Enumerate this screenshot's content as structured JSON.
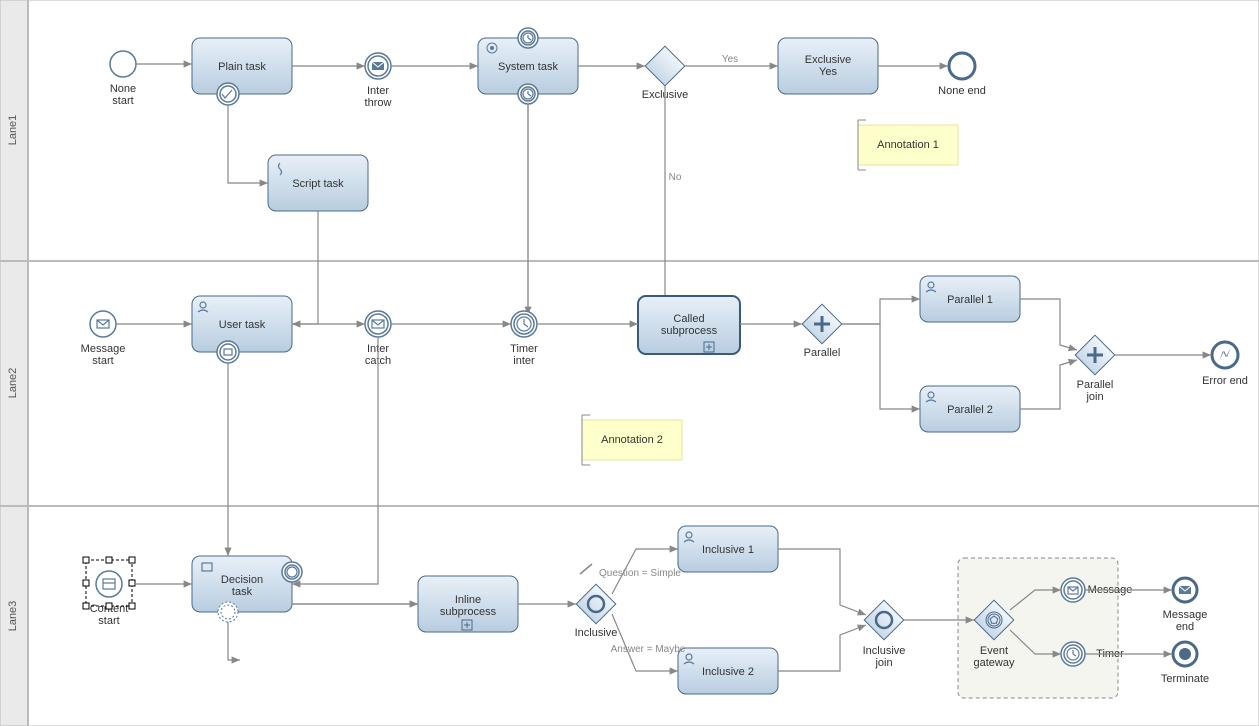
{
  "lanes": {
    "lane1": "Lane1",
    "lane2": "Lane2",
    "lane3": "Lane3"
  },
  "events": {
    "noneStart": "None\nstart",
    "interThrow": "Inter\nthrow",
    "noneEnd": "None end",
    "messageStart": "Message\nstart",
    "interCatch": "Inter\ncatch",
    "timerInter": "Timer\ninter",
    "parallel": "Parallel",
    "parallelJoin": "Parallel\njoin",
    "errorEnd": "Error end",
    "contentStart": "Content\nstart",
    "inclusive": "Inclusive",
    "inclusiveJoin": "Inclusive\njoin",
    "eventGateway": "Event\ngateway",
    "message": "Message",
    "timer": "Timer",
    "messageEnd": "Message\nend",
    "terminate": "Terminate",
    "exclusive": "Exclusive"
  },
  "tasks": {
    "plain": "Plain task",
    "system": "System task",
    "exclusiveYes": "Exclusive\nYes",
    "script": "Script task",
    "user": "User task",
    "called": "Called\nsubprocess",
    "parallel1": "Parallel 1",
    "parallel2": "Parallel 2",
    "decision": "Decision\ntask",
    "inlineSub": "Inline\nsubprocess",
    "inclusive1": "Inclusive 1",
    "inclusive2": "Inclusive 2"
  },
  "annotations": {
    "a1": "Annotation 1",
    "a2": "Annotation 2"
  },
  "edgeLabels": {
    "yes": "Yes",
    "no": "No",
    "q1": "Question = Simple",
    "q2": "Answer = Maybe"
  }
}
